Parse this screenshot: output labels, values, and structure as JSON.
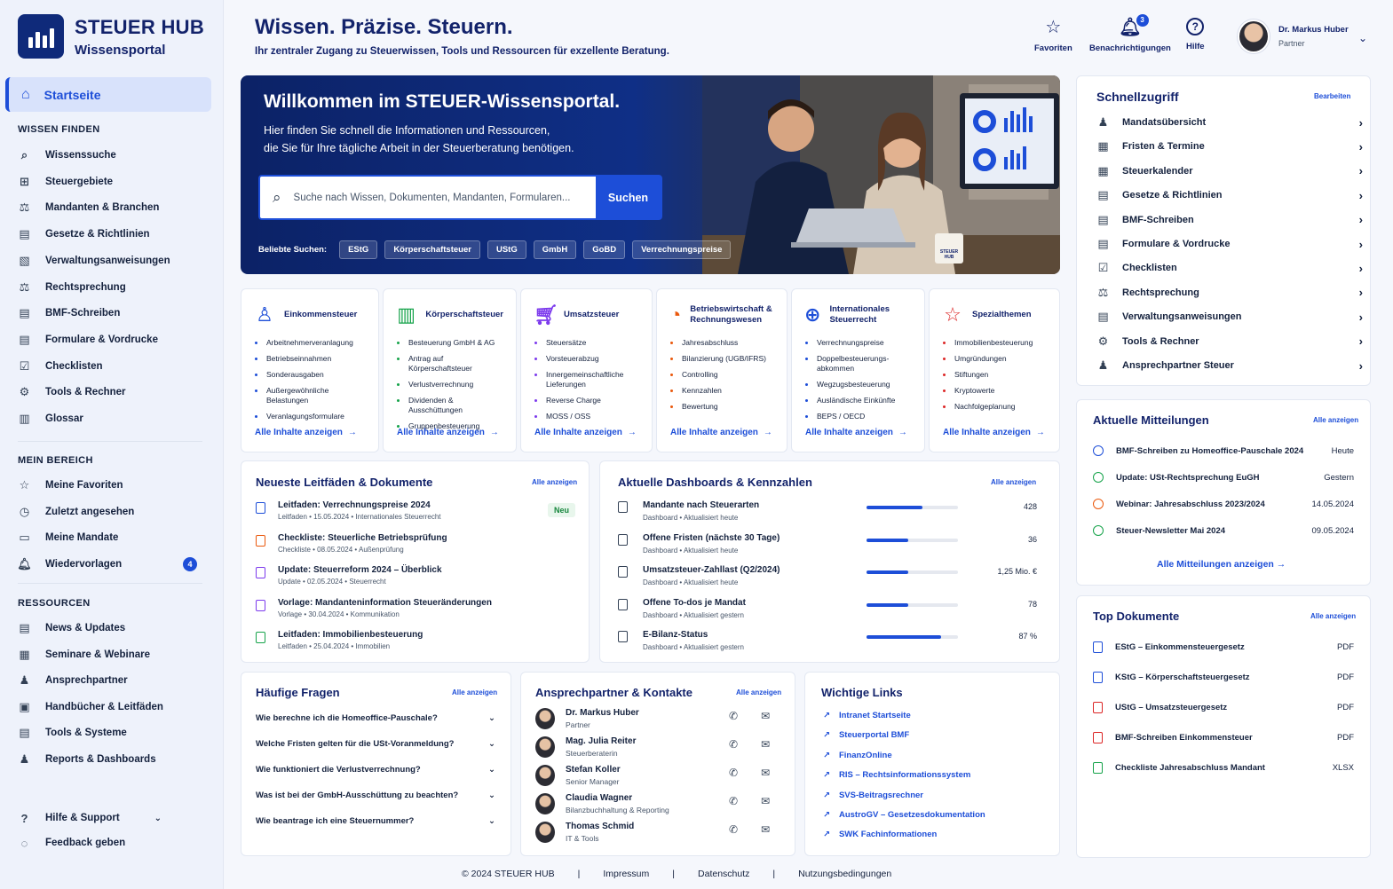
{
  "brand": {
    "name": "STEUER HUB",
    "sub": "Wissensportal"
  },
  "nav": {
    "active": "Startseite",
    "section1": "WISSEN FINDEN",
    "items1": [
      "Wissenssuche",
      "Steuergebiete",
      "Mandanten & Branchen",
      "Gesetze & Richtlinien",
      "Verwaltungsanweisungen",
      "Rechtsprechung",
      "BMF-Schreiben",
      "Formulare & Vordrucke",
      "Checklisten",
      "Tools & Rechner",
      "Glossar"
    ],
    "section2": "MEIN BEREICH",
    "items2": [
      "Meine Favoriten",
      "Zuletzt angesehen",
      "Meine Mandate",
      "Wiedervorlagen"
    ],
    "wiedervorlagen_badge": "4",
    "section3": "RESSOURCEN",
    "items3": [
      "News & Updates",
      "Seminare & Webinare",
      "Ansprechpartner",
      "Handbücher & Leitfäden",
      "Tools & Systeme",
      "Reports & Dashboards"
    ],
    "help": "Hilfe & Support",
    "feedback": "Feedback geben"
  },
  "header": {
    "title": "Wissen. Präzise. Steuern.",
    "subtitle": "Ihr zentraler Zugang zu Steuerwissen, Tools und Ressourcen für exzellente Beratung.",
    "favorites": "Favoriten",
    "notifications": "Benachrichtigungen",
    "notif_count": "3",
    "help": "Hilfe",
    "user_name": "Dr. Markus Huber",
    "user_role": "Partner"
  },
  "hero": {
    "title": "Willkommen im STEUER-Wissensportal.",
    "line1": "Hier finden Sie schnell die Informationen und Ressourcen,",
    "line2": "die Sie für Ihre tägliche Arbeit in der Steuerberatung benötigen.",
    "search_placeholder": "Suche nach Wissen, Dokumenten, Mandanten, Formularen...",
    "search_button": "Suchen",
    "popular_label": "Beliebte Suchen:",
    "popular": [
      "EStG",
      "Körperschaftsteuer",
      "UStG",
      "GmbH",
      "GoBD",
      "Verrechnungspreise"
    ],
    "mug_text": "STEUER HUB"
  },
  "categories": [
    {
      "title": "Einkommensteuer",
      "color": "#1d4ed8",
      "items": [
        "Arbeitnehmerveranlagung",
        "Betriebseinnahmen",
        "Sonderausgaben",
        "Außergewöhnliche Belastungen",
        "Veranlagungsformulare"
      ],
      "more": "Alle Inhalte anzeigen"
    },
    {
      "title": "Körperschaftsteuer",
      "color": "#16a34a",
      "items": [
        "Besteuerung GmbH & AG",
        "Antrag auf Körperschaftsteuer",
        "Verlustverrechnung",
        "Dividenden & Ausschüttungen",
        "Gruppenbesteuerung"
      ],
      "more": "Alle Inhalte anzeigen"
    },
    {
      "title": "Umsatzsteuer",
      "color": "#7c3aed",
      "items": [
        "Steuersätze",
        "Vorsteuerabzug",
        "Innergemeinschaftliche Lieferungen",
        "Reverse Charge",
        "MOSS / OSS"
      ],
      "more": "Alle Inhalte anzeigen"
    },
    {
      "title": "Betriebswirtschaft & Rechnungswesen",
      "color": "#ea580c",
      "items": [
        "Jahresabschluss",
        "Bilanzierung (UGB/IFRS)",
        "Controlling",
        "Kennzahlen",
        "Bewertung"
      ],
      "more": "Alle Inhalte anzeigen"
    },
    {
      "title": "Internationales Steuerrecht",
      "color": "#1d4ed8",
      "items": [
        "Verrechnungspreise",
        "Doppelbesteuerungs-abkommen",
        "Wegzugsbesteuerung",
        "Ausländische Einkünfte",
        "BEPS / OECD"
      ],
      "more": "Alle Inhalte anzeigen"
    },
    {
      "title": "Spezialthemen",
      "color": "#dc2626",
      "items": [
        "Immobilienbesteuerung",
        "Umgründungen",
        "Stiftungen",
        "Kryptowerte",
        "Nachfolgeplanung"
      ],
      "more": "Alle Inhalte anzeigen"
    }
  ],
  "docs": {
    "title": "Neueste Leitfäden & Dokumente",
    "link": "Alle anzeigen",
    "new_badge": "Neu",
    "items": [
      {
        "title": "Leitfaden: Verrechnungspreise 2024",
        "meta": "Leitfaden   •   15.05.2024   •   Internationales Steuerrecht",
        "color": "#1d4ed8"
      },
      {
        "title": "Checkliste: Steuerliche Betriebsprüfung",
        "meta": "Checkliste   •   08.05.2024   •   Außenprüfung",
        "color": "#ea580c"
      },
      {
        "title": "Update: Steuerreform 2024 – Überblick",
        "meta": "Update   •   02.05.2024   •   Steuerrecht",
        "color": "#7c3aed"
      },
      {
        "title": "Vorlage: Mandanteninformation Steueränderungen",
        "meta": "Vorlage   •   30.04.2024   •   Kommunikation",
        "color": "#7c3aed"
      },
      {
        "title": "Leitfaden: Immobilienbesteuerung",
        "meta": "Leitfaden   •   25.04.2024   •   Immobilien",
        "color": "#16a34a"
      }
    ]
  },
  "dashboards": {
    "title": "Aktuelle Dashboards & Kennzahlen",
    "link": "Alle anzeigen",
    "items": [
      {
        "title": "Mandante nach Steuerarten",
        "meta": "Dashboard   •   Aktualisiert heute",
        "value": "428",
        "fill": 0.61
      },
      {
        "title": "Offene Fristen (nächste 30 Tage)",
        "meta": "Dashboard   •   Aktualisiert heute",
        "value": "36",
        "fill": 0.46
      },
      {
        "title": "Umsatzsteuer-Zahllast (Q2/2024)",
        "meta": "Dashboard   •   Aktualisiert heute",
        "value": "1,25 Mio. €",
        "fill": 0.46
      },
      {
        "title": "Offene To-dos je Mandat",
        "meta": "Dashboard   •   Aktualisiert gestern",
        "value": "78",
        "fill": 0.46
      },
      {
        "title": "E-Bilanz-Status",
        "meta": "Dashboard   •   Aktualisiert gestern",
        "value": "87 %",
        "fill": 0.82
      }
    ]
  },
  "faq": {
    "title": "Häufige Fragen",
    "link": "Alle anzeigen",
    "items": [
      "Wie berechne ich die Homeoffice-Pauschale?",
      "Welche Fristen gelten für die USt-Voranmeldung?",
      "Wie funktioniert die Verlustverrechnung?",
      "Was ist bei der GmbH-Ausschüttung zu beachten?",
      "Wie beantrage ich eine Steuernummer?"
    ]
  },
  "contacts": {
    "title": "Ansprechpartner & Kontakte",
    "link": "Alle anzeigen",
    "items": [
      {
        "name": "Dr. Markus Huber",
        "role": "Partner"
      },
      {
        "name": "Mag. Julia Reiter",
        "role": "Steuerberaterin"
      },
      {
        "name": "Stefan Koller",
        "role": "Senior Manager"
      },
      {
        "name": "Claudia Wagner",
        "role": "Bilanzbuchhaltung & Reporting"
      },
      {
        "name": "Thomas Schmid",
        "role": "IT & Tools"
      }
    ]
  },
  "links": {
    "title": "Wichtige Links",
    "items": [
      "Intranet Startseite",
      "Steuerportal BMF",
      "FinanzOnline",
      "RIS – Rechtsinformationssystem",
      "SVS-Beitragsrechner",
      "AustroGV – Gesetzesdokumentation",
      "SWK Fachinformationen"
    ]
  },
  "quick": {
    "title": "Schnellzugriff",
    "edit": "Bearbeiten",
    "items": [
      "Mandatsübersicht",
      "Fristen & Termine",
      "Steuerkalender",
      "Gesetze & Richtlinien",
      "BMF-Schreiben",
      "Formulare & Vordrucke",
      "Checklisten",
      "Rechtsprechung",
      "Verwaltungsanweisungen",
      "Tools & Rechner",
      "Ansprechpartner Steuer"
    ]
  },
  "news": {
    "title": "Aktuelle Mitteilungen",
    "link": "Alle anzeigen",
    "items": [
      {
        "title": "BMF-Schreiben zu Homeoffice-Pauschale 2024",
        "date": "Heute",
        "color": "#1d4ed8"
      },
      {
        "title": "Update: USt-Rechtsprechung EuGH",
        "date": "Gestern",
        "color": "#16a34a"
      },
      {
        "title": "Webinar: Jahresabschluss 2023/2024",
        "date": "14.05.2024",
        "color": "#ea580c"
      },
      {
        "title": "Steuer-Newsletter Mai 2024",
        "date": "09.05.2024",
        "color": "#16a34a"
      }
    ],
    "all": "Alle Mitteilungen anzeigen"
  },
  "topdocs": {
    "title": "Top Dokumente",
    "link": "Alle anzeigen",
    "items": [
      {
        "title": "EStG – Einkommensteuergesetz",
        "type": "PDF",
        "color": "#1d4ed8"
      },
      {
        "title": "KStG – Körperschaftsteuergesetz",
        "type": "PDF",
        "color": "#1d4ed8"
      },
      {
        "title": "UStG – Umsatzsteuergesetz",
        "type": "PDF",
        "color": "#dc2626"
      },
      {
        "title": "BMF-Schreiben Einkommensteuer",
        "type": "PDF",
        "color": "#dc2626"
      },
      {
        "title": "Checkliste Jahresabschluss Mandant",
        "type": "XLSX",
        "color": "#16a34a"
      }
    ]
  },
  "footer": {
    "copy": "© 2024 STEUER HUB",
    "sep": "|",
    "impressum": "Impressum",
    "datenschutz": "Datenschutz",
    "nutzung": "Nutzungsbedingungen"
  }
}
